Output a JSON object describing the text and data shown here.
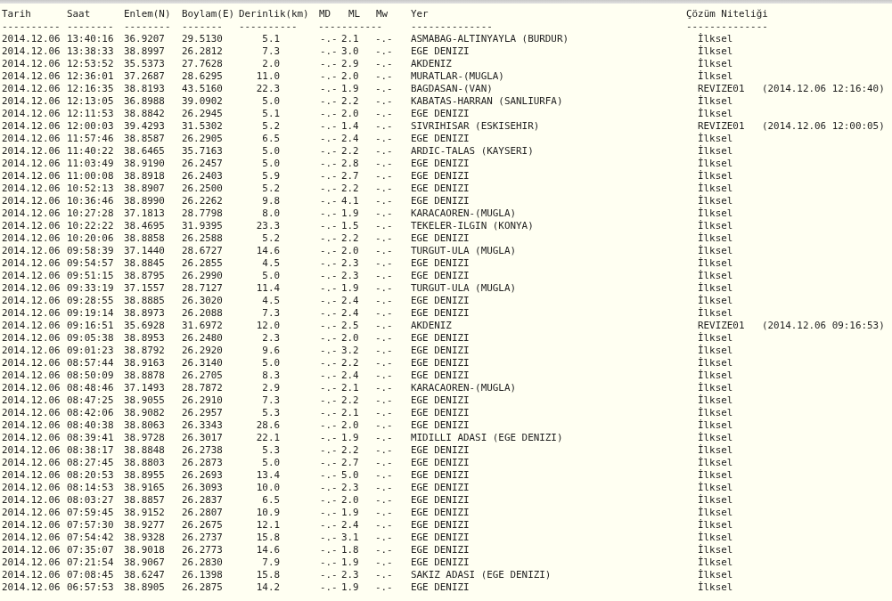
{
  "headers": [
    "Tarih",
    "Saat",
    "Enlem(N)",
    "Boylam(E)",
    "Derinlik(km)",
    "MD",
    "ML",
    "Mw",
    "Yer",
    "Çözüm Niteliği"
  ],
  "separators": [
    "----------",
    "--------",
    "--------",
    "-------",
    "----------",
    "-----------",
    "--------------",
    "--------------"
  ],
  "rows": [
    {
      "date": "2014.12.06",
      "time": "13:40:16",
      "lat": "36.9207",
      "lon": "29.5130",
      "depth": "5.1",
      "md": "-.-",
      "ml": "2.1",
      "mw": "-.-",
      "place": "ASMABAG-ALTINYAYLA (BURDUR)",
      "solution": "İlksel"
    },
    {
      "date": "2014.12.06",
      "time": "13:38:33",
      "lat": "38.8997",
      "lon": "26.2812",
      "depth": "7.3",
      "md": "-.-",
      "ml": "3.0",
      "mw": "-.-",
      "place": "EGE DENIZI",
      "solution": "İlksel"
    },
    {
      "date": "2014.12.06",
      "time": "12:53:52",
      "lat": "35.5373",
      "lon": "27.7628",
      "depth": "2.0",
      "md": "-.-",
      "ml": "2.9",
      "mw": "-.-",
      "place": "AKDENIZ",
      "solution": "İlksel"
    },
    {
      "date": "2014.12.06",
      "time": "12:36:01",
      "lat": "37.2687",
      "lon": "28.6295",
      "depth": "11.0",
      "md": "-.-",
      "ml": "2.0",
      "mw": "-.-",
      "place": "MURATLAR-(MUGLA)",
      "solution": "İlksel"
    },
    {
      "date": "2014.12.06",
      "time": "12:16:35",
      "lat": "38.8193",
      "lon": "43.5160",
      "depth": "22.3",
      "md": "-.-",
      "ml": "1.9",
      "mw": "-.-",
      "place": "BAGDASAN-(VAN)",
      "solution": "REVIZE01",
      "revision_time": "(2014.12.06 12:16:40)"
    },
    {
      "date": "2014.12.06",
      "time": "12:13:05",
      "lat": "36.8988",
      "lon": "39.0902",
      "depth": "5.0",
      "md": "-.-",
      "ml": "2.2",
      "mw": "-.-",
      "place": "KABATAS-HARRAN (SANLIURFA)",
      "solution": "İlksel"
    },
    {
      "date": "2014.12.06",
      "time": "12:11:53",
      "lat": "38.8842",
      "lon": "26.2945",
      "depth": "5.1",
      "md": "-.-",
      "ml": "2.0",
      "mw": "-.-",
      "place": "EGE DENIZI",
      "solution": "İlksel"
    },
    {
      "date": "2014.12.06",
      "time": "12:00:03",
      "lat": "39.4293",
      "lon": "31.5302",
      "depth": "5.2",
      "md": "-.-",
      "ml": "1.4",
      "mw": "-.-",
      "place": "SIVRIHISAR (ESKISEHIR)",
      "solution": "REVIZE01",
      "revision_time": "(2014.12.06 12:00:05)"
    },
    {
      "date": "2014.12.06",
      "time": "11:57:46",
      "lat": "38.8587",
      "lon": "26.2905",
      "depth": "6.5",
      "md": "-.-",
      "ml": "2.4",
      "mw": "-.-",
      "place": "EGE DENIZI",
      "solution": "İlksel"
    },
    {
      "date": "2014.12.06",
      "time": "11:40:22",
      "lat": "38.6465",
      "lon": "35.7163",
      "depth": "5.0",
      "md": "-.-",
      "ml": "2.2",
      "mw": "-.-",
      "place": "ARDIC-TALAS (KAYSERI)",
      "solution": "İlksel"
    },
    {
      "date": "2014.12.06",
      "time": "11:03:49",
      "lat": "38.9190",
      "lon": "26.2457",
      "depth": "5.0",
      "md": "-.-",
      "ml": "2.8",
      "mw": "-.-",
      "place": "EGE DENIZI",
      "solution": "İlksel"
    },
    {
      "date": "2014.12.06",
      "time": "11:00:08",
      "lat": "38.8918",
      "lon": "26.2403",
      "depth": "5.9",
      "md": "-.-",
      "ml": "2.7",
      "mw": "-.-",
      "place": "EGE DENIZI",
      "solution": "İlksel"
    },
    {
      "date": "2014.12.06",
      "time": "10:52:13",
      "lat": "38.8907",
      "lon": "26.2500",
      "depth": "5.2",
      "md": "-.-",
      "ml": "2.2",
      "mw": "-.-",
      "place": "EGE DENIZI",
      "solution": "İlksel"
    },
    {
      "date": "2014.12.06",
      "time": "10:36:46",
      "lat": "38.8990",
      "lon": "26.2262",
      "depth": "9.8",
      "md": "-.-",
      "ml": "4.1",
      "mw": "-.-",
      "place": "EGE DENIZI",
      "solution": "İlksel"
    },
    {
      "date": "2014.12.06",
      "time": "10:27:28",
      "lat": "37.1813",
      "lon": "28.7798",
      "depth": "8.0",
      "md": "-.-",
      "ml": "1.9",
      "mw": "-.-",
      "place": "KARACAOREN-(MUGLA)",
      "solution": "İlksel"
    },
    {
      "date": "2014.12.06",
      "time": "10:22:22",
      "lat": "38.4695",
      "lon": "31.9395",
      "depth": "23.3",
      "md": "-.-",
      "ml": "1.5",
      "mw": "-.-",
      "place": "TEKELER-ILGIN (KONYA)",
      "solution": "İlksel"
    },
    {
      "date": "2014.12.06",
      "time": "10:20:06",
      "lat": "38.8858",
      "lon": "26.2588",
      "depth": "5.2",
      "md": "-.-",
      "ml": "2.2",
      "mw": "-.-",
      "place": "EGE DENIZI",
      "solution": "İlksel"
    },
    {
      "date": "2014.12.06",
      "time": "09:58:39",
      "lat": "37.1440",
      "lon": "28.6727",
      "depth": "14.6",
      "md": "-.-",
      "ml": "2.0",
      "mw": "-.-",
      "place": "TURGUT-ULA (MUGLA)",
      "solution": "İlksel"
    },
    {
      "date": "2014.12.06",
      "time": "09:54:57",
      "lat": "38.8845",
      "lon": "26.2855",
      "depth": "4.5",
      "md": "-.-",
      "ml": "2.3",
      "mw": "-.-",
      "place": "EGE DENIZI",
      "solution": "İlksel"
    },
    {
      "date": "2014.12.06",
      "time": "09:51:15",
      "lat": "38.8795",
      "lon": "26.2990",
      "depth": "5.0",
      "md": "-.-",
      "ml": "2.3",
      "mw": "-.-",
      "place": "EGE DENIZI",
      "solution": "İlksel"
    },
    {
      "date": "2014.12.06",
      "time": "09:33:19",
      "lat": "37.1557",
      "lon": "28.7127",
      "depth": "11.4",
      "md": "-.-",
      "ml": "1.9",
      "mw": "-.-",
      "place": "TURGUT-ULA (MUGLA)",
      "solution": "İlksel"
    },
    {
      "date": "2014.12.06",
      "time": "09:28:55",
      "lat": "38.8885",
      "lon": "26.3020",
      "depth": "4.5",
      "md": "-.-",
      "ml": "2.4",
      "mw": "-.-",
      "place": "EGE DENIZI",
      "solution": "İlksel"
    },
    {
      "date": "2014.12.06",
      "time": "09:19:14",
      "lat": "38.8973",
      "lon": "26.2088",
      "depth": "7.3",
      "md": "-.-",
      "ml": "2.4",
      "mw": "-.-",
      "place": "EGE DENIZI",
      "solution": "İlksel"
    },
    {
      "date": "2014.12.06",
      "time": "09:16:51",
      "lat": "35.6928",
      "lon": "31.6972",
      "depth": "12.0",
      "md": "-.-",
      "ml": "2.5",
      "mw": "-.-",
      "place": "AKDENIZ",
      "solution": "REVIZE01",
      "revision_time": "(2014.12.06 09:16:53)"
    },
    {
      "date": "2014.12.06",
      "time": "09:05:38",
      "lat": "38.8953",
      "lon": "26.2480",
      "depth": "2.3",
      "md": "-.-",
      "ml": "2.0",
      "mw": "-.-",
      "place": "EGE DENIZI",
      "solution": "İlksel"
    },
    {
      "date": "2014.12.06",
      "time": "09:01:23",
      "lat": "38.8792",
      "lon": "26.2920",
      "depth": "9.6",
      "md": "-.-",
      "ml": "3.2",
      "mw": "-.-",
      "place": "EGE DENIZI",
      "solution": "İlksel"
    },
    {
      "date": "2014.12.06",
      "time": "08:57:44",
      "lat": "38.9163",
      "lon": "26.3140",
      "depth": "5.0",
      "md": "-.-",
      "ml": "2.2",
      "mw": "-.-",
      "place": "EGE DENIZI",
      "solution": "İlksel"
    },
    {
      "date": "2014.12.06",
      "time": "08:50:09",
      "lat": "38.8878",
      "lon": "26.2705",
      "depth": "8.3",
      "md": "-.-",
      "ml": "2.4",
      "mw": "-.-",
      "place": "EGE DENIZI",
      "solution": "İlksel"
    },
    {
      "date": "2014.12.06",
      "time": "08:48:46",
      "lat": "37.1493",
      "lon": "28.7872",
      "depth": "2.9",
      "md": "-.-",
      "ml": "2.1",
      "mw": "-.-",
      "place": "KARACAOREN-(MUGLA)",
      "solution": "İlksel"
    },
    {
      "date": "2014.12.06",
      "time": "08:47:25",
      "lat": "38.9055",
      "lon": "26.2910",
      "depth": "7.3",
      "md": "-.-",
      "ml": "2.2",
      "mw": "-.-",
      "place": "EGE DENIZI",
      "solution": "İlksel"
    },
    {
      "date": "2014.12.06",
      "time": "08:42:06",
      "lat": "38.9082",
      "lon": "26.2957",
      "depth": "5.3",
      "md": "-.-",
      "ml": "2.1",
      "mw": "-.-",
      "place": "EGE DENIZI",
      "solution": "İlksel"
    },
    {
      "date": "2014.12.06",
      "time": "08:40:38",
      "lat": "38.8063",
      "lon": "26.3343",
      "depth": "28.6",
      "md": "-.-",
      "ml": "2.0",
      "mw": "-.-",
      "place": "EGE DENIZI",
      "solution": "İlksel"
    },
    {
      "date": "2014.12.06",
      "time": "08:39:41",
      "lat": "38.9728",
      "lon": "26.3017",
      "depth": "22.1",
      "md": "-.-",
      "ml": "1.9",
      "mw": "-.-",
      "place": "MIDILLI ADASI (EGE DENIZI)",
      "solution": "İlksel"
    },
    {
      "date": "2014.12.06",
      "time": "08:38:17",
      "lat": "38.8848",
      "lon": "26.2738",
      "depth": "5.3",
      "md": "-.-",
      "ml": "2.2",
      "mw": "-.-",
      "place": "EGE DENIZI",
      "solution": "İlksel"
    },
    {
      "date": "2014.12.06",
      "time": "08:27:45",
      "lat": "38.8803",
      "lon": "26.2873",
      "depth": "5.0",
      "md": "-.-",
      "ml": "2.7",
      "mw": "-.-",
      "place": "EGE DENIZI",
      "solution": "İlksel"
    },
    {
      "date": "2014.12.06",
      "time": "08:20:53",
      "lat": "38.8955",
      "lon": "26.2693",
      "depth": "13.4",
      "md": "-.-",
      "ml": "5.0",
      "mw": "-.-",
      "place": "EGE DENIZI",
      "solution": "İlksel"
    },
    {
      "date": "2014.12.06",
      "time": "08:14:53",
      "lat": "38.9165",
      "lon": "26.3093",
      "depth": "10.0",
      "md": "-.-",
      "ml": "2.3",
      "mw": "-.-",
      "place": "EGE DENIZI",
      "solution": "İlksel"
    },
    {
      "date": "2014.12.06",
      "time": "08:03:27",
      "lat": "38.8857",
      "lon": "26.2837",
      "depth": "6.5",
      "md": "-.-",
      "ml": "2.0",
      "mw": "-.-",
      "place": "EGE DENIZI",
      "solution": "İlksel"
    },
    {
      "date": "2014.12.06",
      "time": "07:59:45",
      "lat": "38.9152",
      "lon": "26.2807",
      "depth": "10.9",
      "md": "-.-",
      "ml": "1.9",
      "mw": "-.-",
      "place": "EGE DENIZI",
      "solution": "İlksel"
    },
    {
      "date": "2014.12.06",
      "time": "07:57:30",
      "lat": "38.9277",
      "lon": "26.2675",
      "depth": "12.1",
      "md": "-.-",
      "ml": "2.4",
      "mw": "-.-",
      "place": "EGE DENIZI",
      "solution": "İlksel"
    },
    {
      "date": "2014.12.06",
      "time": "07:54:42",
      "lat": "38.9328",
      "lon": "26.2737",
      "depth": "15.8",
      "md": "-.-",
      "ml": "3.1",
      "mw": "-.-",
      "place": "EGE DENIZI",
      "solution": "İlksel"
    },
    {
      "date": "2014.12.06",
      "time": "07:35:07",
      "lat": "38.9018",
      "lon": "26.2773",
      "depth": "14.6",
      "md": "-.-",
      "ml": "1.8",
      "mw": "-.-",
      "place": "EGE DENIZI",
      "solution": "İlksel"
    },
    {
      "date": "2014.12.06",
      "time": "07:21:54",
      "lat": "38.9067",
      "lon": "26.2830",
      "depth": "7.9",
      "md": "-.-",
      "ml": "1.9",
      "mw": "-.-",
      "place": "EGE DENIZI",
      "solution": "İlksel"
    },
    {
      "date": "2014.12.06",
      "time": "07:08:45",
      "lat": "38.6247",
      "lon": "26.1398",
      "depth": "15.8",
      "md": "-.-",
      "ml": "2.3",
      "mw": "-.-",
      "place": "SAKIZ ADASI (EGE DENIZI)",
      "solution": "İlksel"
    },
    {
      "date": "2014.12.06",
      "time": "06:57:53",
      "lat": "38.8905",
      "lon": "26.2875",
      "depth": "14.2",
      "md": "-.-",
      "ml": "1.9",
      "mw": "-.-",
      "place": "EGE DENIZI",
      "solution": "İlksel"
    }
  ]
}
